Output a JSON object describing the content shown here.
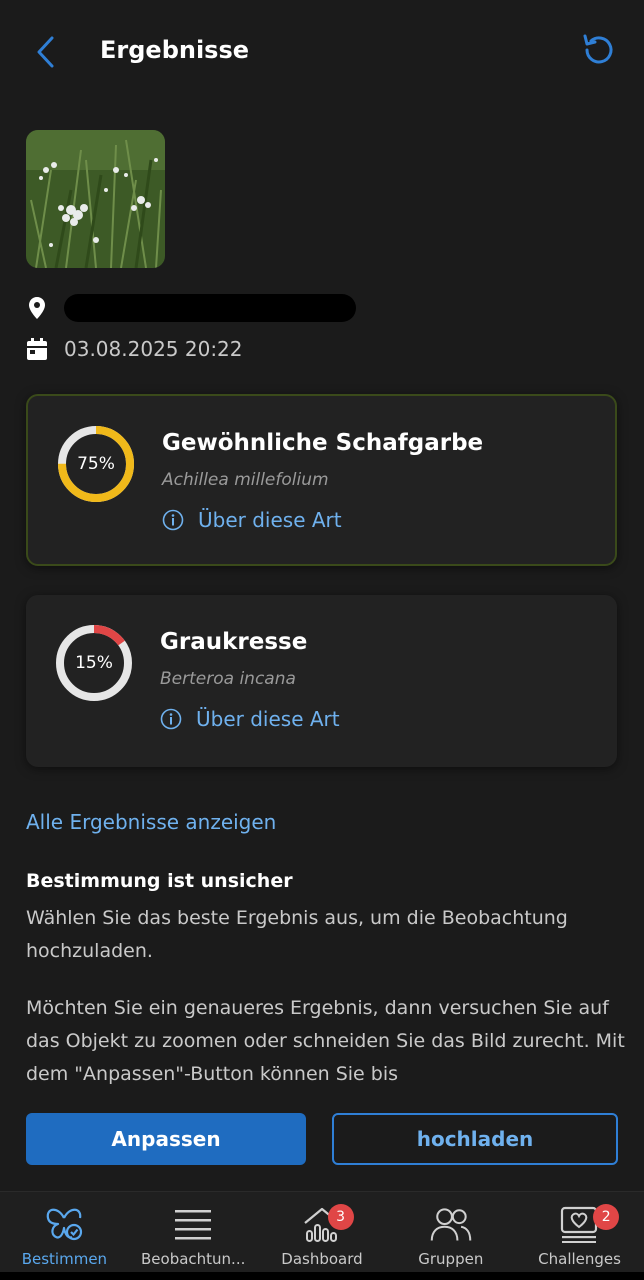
{
  "header": {
    "title": "Ergebnisse",
    "back_icon": "chevron-left-icon",
    "reset_icon": "reset-icon",
    "accent": "#2f7fd6"
  },
  "observation": {
    "photo": "yarrow-flowers-photo",
    "date": "03.08.2025 20:22"
  },
  "results": [
    {
      "name": "Gewöhnliche Schafgarbe",
      "latin": "Achillea millefolium",
      "percent_label": "75%",
      "percent": 75,
      "ring_color": "#f0b91a",
      "about": "Über diese Art"
    },
    {
      "name": "Graukresse",
      "latin": "Berteroa incana",
      "percent_label": "15%",
      "percent": 15,
      "ring_color": "#e04646",
      "about": "Über diese Art"
    }
  ],
  "all_results_link": "Alle Ergebnisse anzeigen",
  "info": {
    "title": "Bestimmung ist unsicher",
    "text": "Wählen Sie das beste Ergebnis aus, um die Beobachtung hochzuladen.",
    "tip": "Möchten Sie ein genaueres Ergebnis, dann versuchen Sie auf das Objekt zu zoomen oder schneiden Sie das Bild zurecht. Mit dem \"Anpassen\"-Button können Sie bis"
  },
  "actions": {
    "adjust": "Anpassen",
    "upload": "hochladen"
  },
  "nav": [
    {
      "label": "Bestimmen",
      "icon": "butterfly-check-icon",
      "active": true
    },
    {
      "label": "Beobachtun...",
      "icon": "list-icon"
    },
    {
      "label": "Dashboard",
      "icon": "chart-home-icon",
      "badge": "3"
    },
    {
      "label": "Gruppen",
      "icon": "people-icon"
    },
    {
      "label": "Challenges",
      "icon": "heart-screen-icon",
      "badge": "2"
    }
  ]
}
